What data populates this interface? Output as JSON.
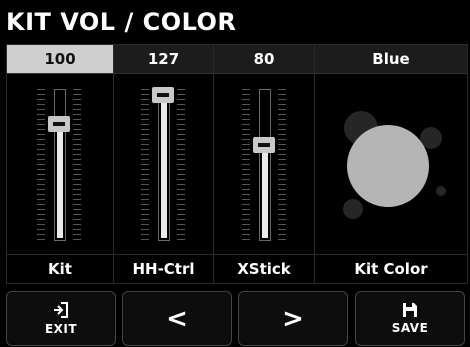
{
  "screen": {
    "title": "KIT VOL / COLOR"
  },
  "faders": [
    {
      "value": "100",
      "label": "Kit",
      "selected": true,
      "level": 0.79
    },
    {
      "value": "127",
      "label": "HH-Ctrl",
      "selected": false,
      "level": 1.0
    },
    {
      "value": "80",
      "label": "XStick",
      "selected": false,
      "level": 0.63
    }
  ],
  "kit_color": {
    "value": "Blue",
    "label": "Kit Color",
    "preview_color": "#b5b5b5"
  },
  "buttons": {
    "exit_label": "EXIT",
    "prev_symbol": "<",
    "next_symbol": ">",
    "save_label": "SAVE"
  },
  "colors": {
    "selected_value_bg": "#cfcfcf",
    "knob": "#c8c8c8"
  }
}
